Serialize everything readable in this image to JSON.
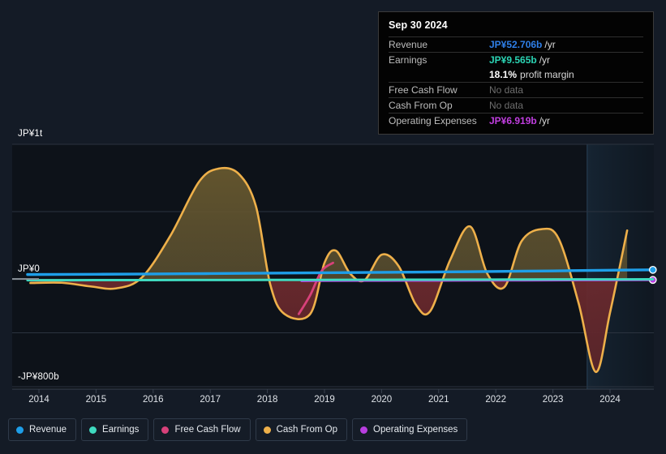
{
  "tooltip": {
    "date": "Sep 30 2024",
    "rows": [
      {
        "label": "Revenue",
        "value": "JP¥52.706b",
        "unit": "/yr",
        "color": "#2f7fe8",
        "nodata": false
      },
      {
        "label": "Earnings",
        "value": "JP¥9.565b",
        "unit": "/yr",
        "color": "#2bd4b4",
        "nodata": false
      },
      {
        "label": "",
        "value": "18.1%",
        "unit": "profit margin",
        "color": "#ffffff",
        "nodata": false,
        "margin": true
      },
      {
        "label": "Free Cash Flow",
        "value": "No data",
        "unit": "",
        "color": "#6d6d6d",
        "nodata": true
      },
      {
        "label": "Cash From Op",
        "value": "No data",
        "unit": "",
        "color": "#6d6d6d",
        "nodata": true
      },
      {
        "label": "Operating Expenses",
        "value": "JP¥6.919b",
        "unit": "/yr",
        "color": "#c13ee0",
        "nodata": false
      }
    ]
  },
  "axis": {
    "y_top": "JP¥1t",
    "y_zero": "JP¥0",
    "y_bottom": "-JP¥800b",
    "x_ticks": [
      "2014",
      "2015",
      "2016",
      "2017",
      "2018",
      "2019",
      "2020",
      "2021",
      "2022",
      "2023",
      "2024"
    ]
  },
  "legend": [
    {
      "label": "Revenue",
      "color": "#1e9ee8"
    },
    {
      "label": "Earnings",
      "color": "#3fdac0"
    },
    {
      "label": "Free Cash Flow",
      "color": "#d8417a"
    },
    {
      "label": "Cash From Op",
      "color": "#eeb04a"
    },
    {
      "label": "Operating Expenses",
      "color": "#b83ee0"
    }
  ],
  "chart_data": {
    "type": "area",
    "title": "",
    "xlabel": "",
    "ylabel": "JP¥",
    "ylim": [
      -800000000000,
      1000000000000
    ],
    "xlim": [
      "2013.7",
      "2024.9"
    ],
    "grid": true,
    "gridlines_y": [
      "JP¥1t",
      "JP¥500b",
      "JP¥0",
      "-JP¥400b",
      "-JP¥800b"
    ],
    "legend_position": "bottom",
    "forecast_region_start": "2023.6",
    "series": [
      {
        "name": "Revenue",
        "color": "#1e9ee8",
        "unit": "JP¥",
        "last_value": 52706000000,
        "x": [
          2013.8,
          2015,
          2016,
          2017,
          2018,
          2019,
          2020,
          2021,
          2022,
          2023,
          2024,
          2024.75
        ],
        "values": [
          18000000000,
          20000000000,
          22000000000,
          25000000000,
          28000000000,
          31000000000,
          34000000000,
          37000000000,
          41000000000,
          45000000000,
          50000000000,
          52706000000
        ]
      },
      {
        "name": "Earnings",
        "color": "#3fdac0",
        "unit": "JP¥",
        "last_value": 9565000000,
        "x": [
          2013.8,
          2015,
          2016,
          2017,
          2018,
          2019,
          2020,
          2021,
          2022,
          2023,
          2024,
          2024.75
        ],
        "values": [
          3000000000,
          3500000000,
          4000000000,
          4500000000,
          5000000000,
          5500000000,
          6200000000,
          7000000000,
          7800000000,
          8600000000,
          9200000000,
          9565000000
        ]
      },
      {
        "name": "Free Cash Flow",
        "color": "#d8417a",
        "unit": "JP¥",
        "last_value": null,
        "x": [
          2018.55,
          2018.75,
          2018.95,
          2019.15
        ],
        "values": [
          -260000000000,
          -120000000000,
          60000000000,
          120000000000
        ]
      },
      {
        "name": "Cash From Op",
        "color": "#eeb04a",
        "unit": "JP¥",
        "last_value": null,
        "x": [
          2013.85,
          2014.4,
          2014.9,
          2015.35,
          2015.8,
          2016.3,
          2016.8,
          2017.15,
          2017.5,
          2017.8,
          2018.05,
          2018.3,
          2018.75,
          2019.0,
          2019.2,
          2019.45,
          2019.7,
          2020.0,
          2020.3,
          2020.6,
          2020.85,
          2021.2,
          2021.55,
          2021.85,
          2022.15,
          2022.45,
          2022.8,
          2023.1,
          2023.45,
          2023.75,
          2024.0,
          2024.3
        ],
        "values": [
          -30000000000,
          -28000000000,
          -55000000000,
          -70000000000,
          10000000000,
          320000000000,
          720000000000,
          820000000000,
          780000000000,
          540000000000,
          -40000000000,
          -260000000000,
          -260000000000,
          120000000000,
          210000000000,
          40000000000,
          -10000000000,
          180000000000,
          95000000000,
          -190000000000,
          -240000000000,
          140000000000,
          390000000000,
          40000000000,
          -60000000000,
          280000000000,
          370000000000,
          300000000000,
          -180000000000,
          -690000000000,
          -250000000000,
          360000000000
        ]
      },
      {
        "name": "Operating Expenses",
        "color": "#b83ee0",
        "unit": "JP¥",
        "last_value": 6919000000,
        "x": [
          2018.6,
          2019,
          2020,
          2021,
          2022,
          2023,
          2024,
          2024.75
        ],
        "values": [
          -14000000000,
          -13000000000,
          -12000000000,
          -11000000000,
          -10000000000,
          -9000000000,
          -7500000000,
          -6919000000
        ]
      }
    ]
  }
}
